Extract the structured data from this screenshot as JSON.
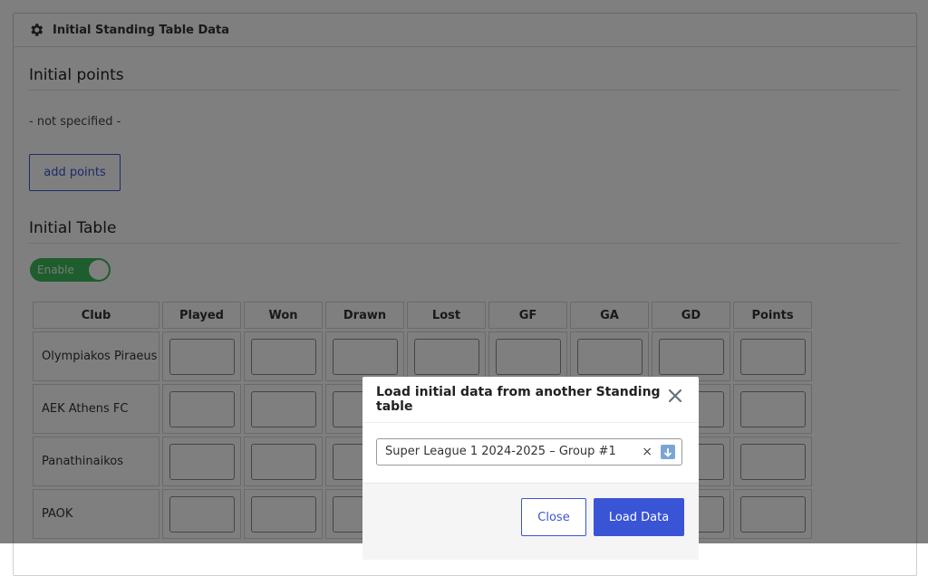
{
  "panel": {
    "title": "Initial Standing Table Data"
  },
  "initial_points": {
    "heading": "Initial points",
    "empty_text": "- not specified -",
    "add_label": "add points"
  },
  "initial_table": {
    "heading": "Initial Table",
    "toggle_label": "Enable",
    "columns": [
      "Club",
      "Played",
      "Won",
      "Drawn",
      "Lost",
      "GF",
      "GA",
      "GD",
      "Points"
    ],
    "rows": [
      {
        "club": "Olympiakos Piraeus"
      },
      {
        "club": "AEK Athens FC"
      },
      {
        "club": "Panathinaikos"
      },
      {
        "club": "PAOK"
      }
    ]
  },
  "modal": {
    "title": "Load initial data from another Standing table",
    "selected_value": "Super League 1 2024-2025 – Group #1",
    "clear_glyph": "×",
    "close_label": "Close",
    "load_label": "Load Data"
  },
  "colors": {
    "accent": "#3a54d6",
    "toggle_on": "#3dbb5b"
  }
}
